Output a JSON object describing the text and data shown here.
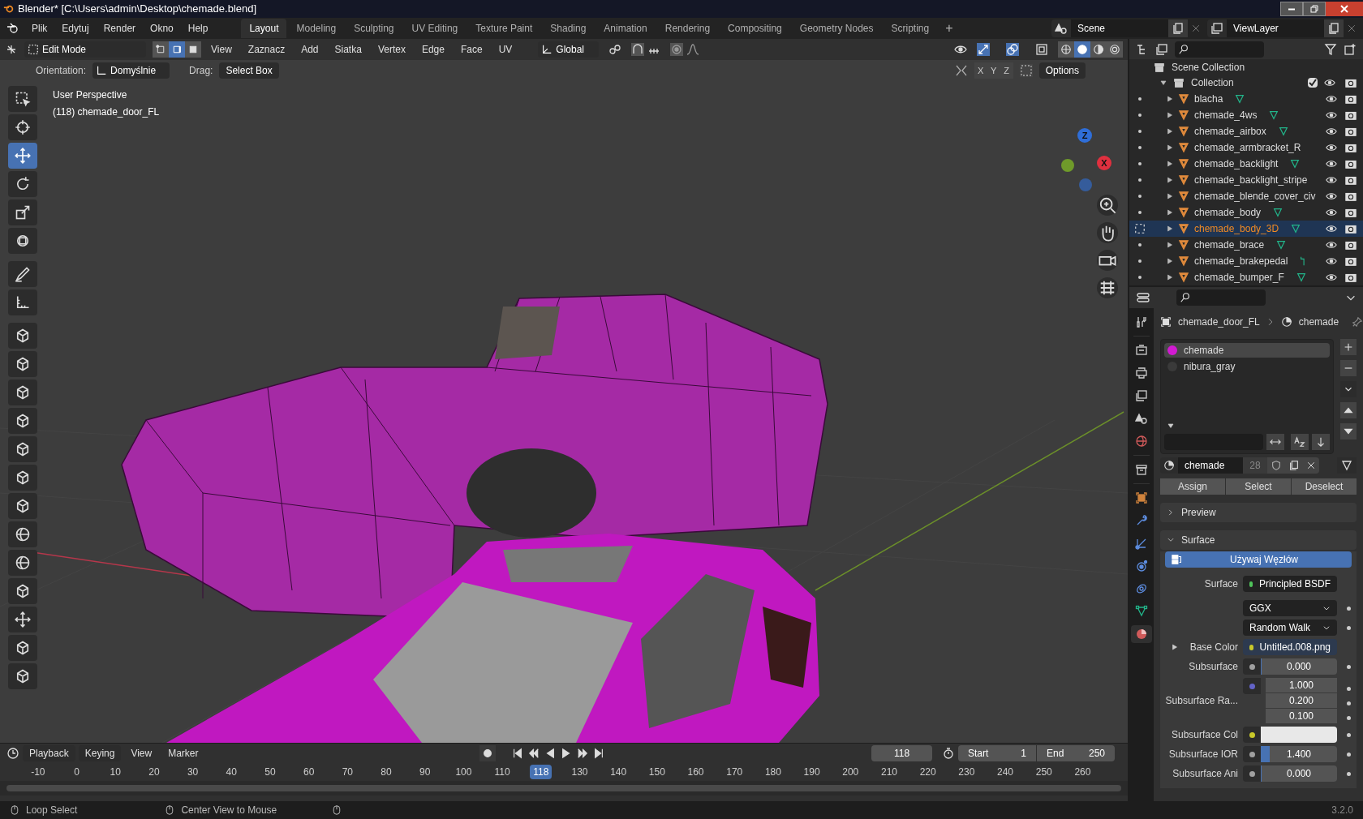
{
  "window": {
    "title": "Blender* [C:\\Users\\admin\\Desktop\\chemade.blend]"
  },
  "menu": [
    "Plik",
    "Edytuj",
    "Render",
    "Okno",
    "Help"
  ],
  "workspaces": [
    {
      "label": "Layout",
      "selected": true
    },
    {
      "label": "Modeling",
      "selected": false
    },
    {
      "label": "Sculpting",
      "selected": false
    },
    {
      "label": "UV Editing",
      "selected": false
    },
    {
      "label": "Texture Paint",
      "selected": false
    },
    {
      "label": "Shading",
      "selected": false
    },
    {
      "label": "Animation",
      "selected": false
    },
    {
      "label": "Rendering",
      "selected": false
    },
    {
      "label": "Compositing",
      "selected": false
    },
    {
      "label": "Geometry Nodes",
      "selected": false
    },
    {
      "label": "Scripting",
      "selected": false
    }
  ],
  "add_workspace": "+",
  "scene": "Scene",
  "view_layer": "ViewLayer",
  "viewport_header": {
    "mode": "Edit Mode",
    "select_modes": [
      {
        "selected": false
      },
      {
        "selected": true
      },
      {
        "selected": false
      }
    ],
    "menus": [
      "View",
      "Zaznacz",
      "Add",
      "Siatka",
      "Vertex",
      "Edge",
      "Face",
      "UV"
    ],
    "orientation": "Global",
    "shading": [
      {
        "selected": false
      },
      {
        "selected": true
      },
      {
        "selected": false
      },
      {
        "selected": false
      }
    ]
  },
  "tool_settings": {
    "orientation_label": "Orientation:",
    "orientation": "Domyślnie",
    "drag_label": "Drag:",
    "drag": "Select Box",
    "axes": [
      "X",
      "Y",
      "Z"
    ],
    "options": "Options"
  },
  "toolbar": [
    {
      "kind": "select",
      "selected": false
    },
    {
      "kind": "cursor",
      "selected": false
    },
    {
      "kind": "move",
      "selected": true
    },
    {
      "kind": "rotate",
      "selected": false
    },
    {
      "kind": "scale",
      "selected": false
    },
    {
      "kind": "transform",
      "selected": false
    },
    {
      "kind": "annotate",
      "selected": false
    },
    {
      "kind": "measure",
      "selected": false
    },
    {
      "kind": "cube",
      "selected": false
    },
    {
      "kind": "cube",
      "selected": false
    },
    {
      "kind": "cube",
      "selected": false
    },
    {
      "kind": "cube",
      "selected": false
    },
    {
      "kind": "cube",
      "selected": false
    },
    {
      "kind": "cube",
      "selected": false
    },
    {
      "kind": "cube",
      "selected": false
    },
    {
      "kind": "sphere",
      "selected": false
    },
    {
      "kind": "sphere",
      "selected": false
    },
    {
      "kind": "cube",
      "selected": false
    },
    {
      "kind": "move",
      "selected": false
    },
    {
      "kind": "cube",
      "selected": false
    },
    {
      "kind": "cube",
      "selected": false
    }
  ],
  "viewport": {
    "view_name": "User Perspective",
    "object_info": "(118) chemade_door_FL",
    "gizmo_axes": [
      {
        "label": "Z",
        "color": "#2f6ed8"
      },
      {
        "label": "X",
        "color": "#e0303f"
      }
    ]
  },
  "outliner": {
    "root": "Scene Collection",
    "collection": {
      "name": "Collection",
      "checked": true,
      "children": [
        {
          "name": "blacha",
          "kind": "mesh",
          "selected": false
        },
        {
          "name": "chemade_4ws",
          "kind": "mesh",
          "selected": false
        },
        {
          "name": "chemade_airbox",
          "kind": "mesh",
          "selected": false
        },
        {
          "name": "chemade_armbracket_R",
          "kind": "plain",
          "selected": false
        },
        {
          "name": "chemade_backlight",
          "kind": "mesh",
          "selected": false
        },
        {
          "name": "chemade_backlight_stripe",
          "kind": "plain",
          "selected": false
        },
        {
          "name": "chemade_blende_cover_civ",
          "kind": "plain",
          "selected": false
        },
        {
          "name": "chemade_body",
          "kind": "mesh",
          "selected": false
        },
        {
          "name": "chemade_body_3D",
          "kind": "mesh",
          "selected": true
        },
        {
          "name": "chemade_brace",
          "kind": "mesh",
          "selected": false
        },
        {
          "name": "chemade_brakepedal",
          "kind": "curve",
          "selected": false
        },
        {
          "name": "chemade_bumper_F",
          "kind": "mesh",
          "selected": false
        }
      ]
    }
  },
  "properties": {
    "tabs": [
      {
        "kind": "tool",
        "selected": false
      },
      {
        "kind": "render",
        "selected": false
      },
      {
        "kind": "output",
        "selected": false
      },
      {
        "kind": "view",
        "selected": false
      },
      {
        "kind": "scene",
        "selected": false
      },
      {
        "kind": "world",
        "selected": false
      },
      {
        "kind": "collection",
        "selected": false
      },
      {
        "kind": "object",
        "selected": false
      },
      {
        "kind": "modifier",
        "selected": false
      },
      {
        "kind": "particles",
        "selected": false
      },
      {
        "kind": "physics",
        "selected": false
      },
      {
        "kind": "constraints",
        "selected": false
      },
      {
        "kind": "data",
        "selected": false
      },
      {
        "kind": "material",
        "selected": true
      }
    ],
    "breadcrumb": [
      "chemade_door_FL",
      "chemade"
    ],
    "slots": [
      {
        "name": "chemade",
        "color": "#d21ad2",
        "selected": true
      },
      {
        "name": "nibura_gray",
        "color": "#3a3a3a",
        "selected": false
      }
    ],
    "material": "chemade",
    "users": "28",
    "buttons": [
      "Assign",
      "Select",
      "Deselect"
    ],
    "panels": [
      {
        "title": "Preview",
        "expanded": false
      },
      {
        "title": "Surface",
        "expanded": true
      }
    ],
    "use_nodes": "Używaj Węzłów",
    "rows": [
      {
        "kind": "link",
        "label": "Surface",
        "value": "Principled BSDF",
        "color": "#4fc35a"
      },
      {
        "kind": "dropdown",
        "value": "GGX"
      },
      {
        "kind": "dropdown",
        "value": "Random Walk"
      },
      {
        "kind": "link",
        "label": "Base Color",
        "value": "Untitled.008.png",
        "color": "#c8c82a",
        "expandable": true
      },
      {
        "kind": "number",
        "label": "Subsurface",
        "value": "0.000",
        "level": 0,
        "color": "#a0a0a0"
      },
      {
        "kind": "vector",
        "label": "Subsurface Ra...",
        "values": [
          "1.000",
          "0.200",
          "0.100"
        ],
        "color": "#6363c7"
      },
      {
        "kind": "color",
        "label": "Subsurface Col",
        "color": "#c8c82a"
      },
      {
        "kind": "number",
        "label": "Subsurface IOR",
        "value": "1.400",
        "level": 0.12,
        "color": "#a0a0a0"
      },
      {
        "kind": "number",
        "label": "Subsurface Ani",
        "value": "0.000",
        "level": 0,
        "color": "#a0a0a0"
      }
    ]
  },
  "timeline": {
    "menus": [
      "Playback",
      "Keying",
      "View",
      "Marker"
    ],
    "current_frame": "118",
    "start_label": "Start",
    "start": "1",
    "end_label": "End",
    "end": "250",
    "ticks": [
      {
        "label": "-10",
        "current": false
      },
      {
        "label": "0",
        "current": false
      },
      {
        "label": "10",
        "current": false
      },
      {
        "label": "20",
        "current": false
      },
      {
        "label": "30",
        "current": false
      },
      {
        "label": "40",
        "current": false
      },
      {
        "label": "50",
        "current": false
      },
      {
        "label": "60",
        "current": false
      },
      {
        "label": "70",
        "current": false
      },
      {
        "label": "80",
        "current": false
      },
      {
        "label": "90",
        "current": false
      },
      {
        "label": "100",
        "current": false
      },
      {
        "label": "110",
        "current": false
      },
      {
        "label": "118",
        "current": true
      },
      {
        "label": "130",
        "current": false
      },
      {
        "label": "140",
        "current": false
      },
      {
        "label": "150",
        "current": false
      },
      {
        "label": "160",
        "current": false
      },
      {
        "label": "170",
        "current": false
      },
      {
        "label": "180",
        "current": false
      },
      {
        "label": "190",
        "current": false
      },
      {
        "label": "200",
        "current": false
      },
      {
        "label": "210",
        "current": false
      },
      {
        "label": "220",
        "current": false
      },
      {
        "label": "230",
        "current": false
      },
      {
        "label": "240",
        "current": false
      },
      {
        "label": "250",
        "current": false
      },
      {
        "label": "260",
        "current": false
      }
    ]
  },
  "status_bar": {
    "hints": [
      "Loop Select",
      "Center View to Mouse"
    ],
    "version": "3.2.0"
  }
}
